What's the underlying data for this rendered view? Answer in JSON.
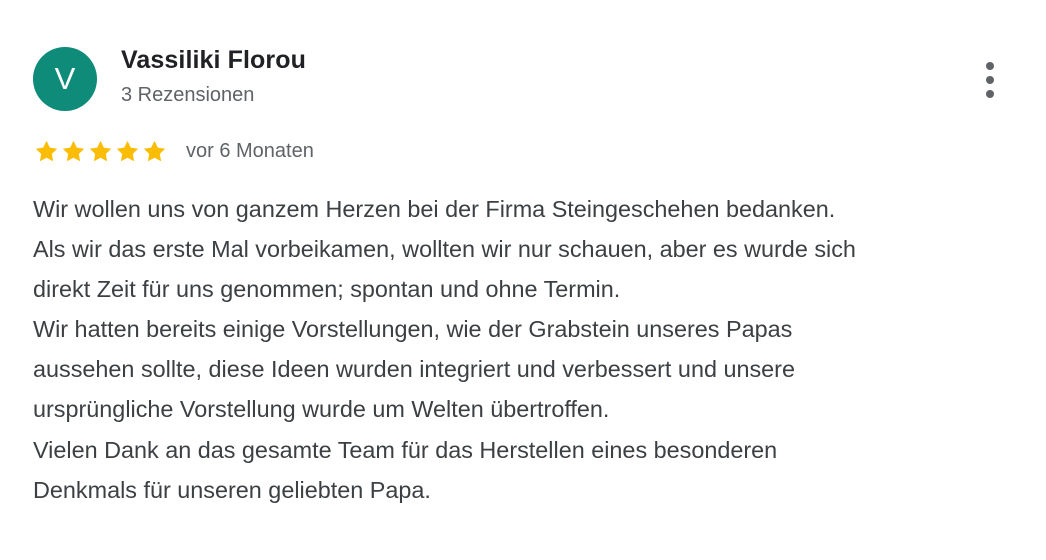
{
  "review": {
    "author": {
      "initial": "V",
      "name": "Vassiliki Florou",
      "review_count": "3 Rezensionen",
      "avatar_color": "#0f8b7a"
    },
    "rating": {
      "stars": 5,
      "max_stars": 5,
      "star_color": "#fbbc04",
      "icon": "star-icon"
    },
    "time_ago": "vor 6 Monaten",
    "more_icon": "more-vert-icon",
    "text_lines": [
      "Wir wollen uns von ganzem Herzen bei der Firma Steingeschehen bedanken.",
      "Als wir das erste Mal vorbeikamen, wollten wir nur schauen, aber es wurde sich",
      "direkt Zeit für uns genommen; spontan und ohne Termin.",
      "Wir hatten bereits einige Vorstellungen, wie der Grabstein unseres Papas",
      "aussehen sollte, diese Ideen wurden integriert und verbessert und unsere",
      "ursprüngliche Vorstellung wurde um Welten übertroffen.",
      "Vielen Dank an das gesamte Team für das Herstellen eines besonderen",
      "Denkmals für unseren geliebten Papa."
    ]
  }
}
